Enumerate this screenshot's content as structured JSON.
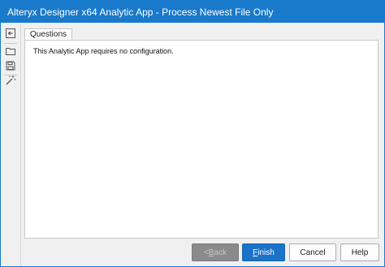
{
  "window": {
    "title": "Alteryx Designer x64 Analytic App - Process Newest File Only",
    "accent_color": "#1979ca"
  },
  "toolbar": {
    "items": [
      {
        "icon": "back-arrow-icon"
      },
      {
        "icon": "folder-open-icon"
      },
      {
        "icon": "save-disk-icon"
      },
      {
        "icon": "magic-wand-icon"
      }
    ]
  },
  "tabs": [
    {
      "label": "Questions",
      "active": true
    }
  ],
  "content": {
    "message": "This Analytic App requires no configuration."
  },
  "buttons": {
    "back": {
      "prefix": "< ",
      "mnemonic": "B",
      "rest": "ack",
      "enabled": false
    },
    "finish": {
      "prefix": "",
      "mnemonic": "F",
      "rest": "inish",
      "enabled": true
    },
    "cancel": {
      "label": "Cancel"
    },
    "help": {
      "label": "Help"
    }
  }
}
